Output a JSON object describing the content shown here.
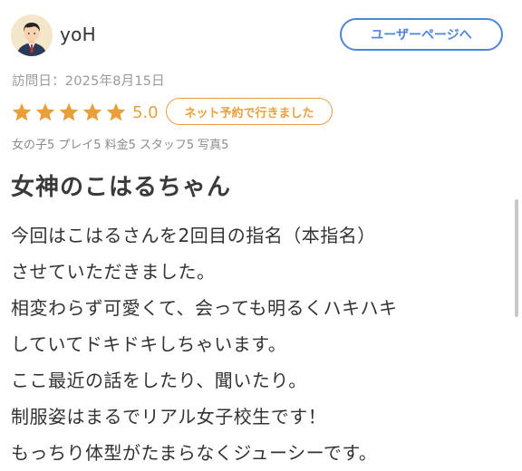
{
  "user": {
    "name": "yoH",
    "page_button": "ユーザーページへ"
  },
  "visit": {
    "date_text": "訪問日：2025年8月15日"
  },
  "rating": {
    "stars": 5,
    "max_stars": 5,
    "score": "5.0",
    "badge": "ネット予約で行きました",
    "star_color": "#e9a03b"
  },
  "subscores": [
    "女の子5",
    "プレイ5",
    "料金5",
    "スタッフ5",
    "写真5"
  ],
  "review": {
    "title": "女神のこはるちゃん",
    "lines": [
      "今回はこはるさんを2回目の指名（本指名）",
      "させていただきました。",
      "相変わらず可愛くて、会っても明るくハキハキ",
      "していてドキドキしちゃいます。",
      "ここ最近の話をしたり、聞いたり。",
      "制服姿はまるでリアル女子校生です！",
      "もっちり体型がたまらなくジューシーです。"
    ]
  },
  "colors": {
    "accent_blue": "#4f85d6",
    "accent_orange": "#e9a03b"
  },
  "icons": {
    "avatar": "user-avatar-icon",
    "star": "star-icon"
  }
}
